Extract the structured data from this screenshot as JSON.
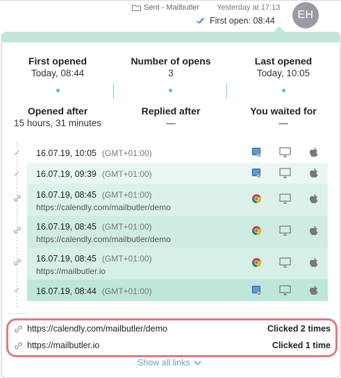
{
  "header": {
    "folder_label": "Sent - Mailbutler",
    "time_label": "Yesterday at 17:13",
    "first_open_label": "First open: 08:44",
    "avatar_initials": "EH"
  },
  "stats_top": [
    {
      "label": "First opened",
      "value": "Today, 08:44"
    },
    {
      "label": "Number of opens",
      "value": "3"
    },
    {
      "label": "Last opened",
      "value": "Today, 10:05"
    }
  ],
  "stats_bottom": [
    {
      "label": "Opened after",
      "value": "15 hours, 31 minutes"
    },
    {
      "label": "Replied after",
      "value": "—"
    },
    {
      "label": "You waited for",
      "value": "—"
    }
  ],
  "events": [
    {
      "datetime": "16.07.19, 10:05",
      "timezone": "(GMT+01:00)",
      "url": "",
      "type": "open",
      "browser": "mail-app",
      "flag": "germany",
      "shaded": false
    },
    {
      "datetime": "16.07.19, 09:39",
      "timezone": "(GMT+01:00)",
      "url": "",
      "type": "open",
      "browser": "mail-app",
      "flag": "germany",
      "shaded": false
    },
    {
      "datetime": "16.07.19, 08:45",
      "timezone": "(GMT+01:00)",
      "url": "https://calendly.com/mailbutler/demo",
      "type": "click",
      "browser": "chrome",
      "flag": "germany",
      "shaded": true
    },
    {
      "datetime": "16.07.19, 08:45",
      "timezone": "(GMT+01:00)",
      "url": "https://calendly.com/mailbutler/demo",
      "type": "click",
      "browser": "chrome",
      "flag": "germany",
      "shaded": true
    },
    {
      "datetime": "16.07.19, 08:45",
      "timezone": "(GMT+01:00)",
      "url": "https://mailbutler.io",
      "type": "click",
      "browser": "chrome",
      "flag": "germany",
      "shaded": true
    },
    {
      "datetime": "16.07.19, 08:44",
      "timezone": "(GMT+01:00)",
      "url": "",
      "type": "open",
      "browser": "mail-app",
      "flag": "germany",
      "shaded": true
    }
  ],
  "links": [
    {
      "url": "https://calendly.com/mailbutler/demo",
      "clicked": "Clicked 2 times"
    },
    {
      "url": "https://mailbutler.io",
      "clicked": "Clicked 1 time"
    }
  ],
  "show_all_label": "Show all links",
  "colors": {
    "accent": "#5cc3aa",
    "row_light": "#eaf6f3",
    "row_mid": "#cfece4",
    "row_dark": "#bfe6db",
    "highlight_border": "#e07a7f",
    "link_blue": "#6c9dc2"
  }
}
